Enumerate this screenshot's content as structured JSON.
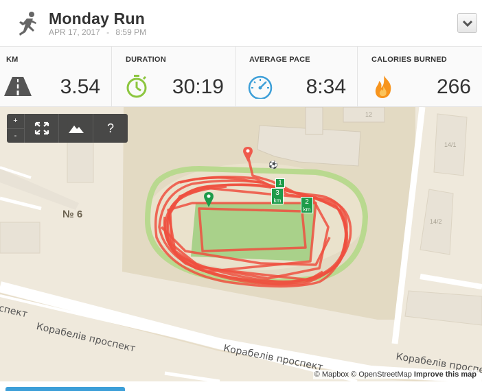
{
  "header": {
    "activity_icon": "runner-icon",
    "title": "Monday Run",
    "date": "APR 17, 2017",
    "separator": "-",
    "time": "8:59 PM",
    "dropdown_icon": "chevron-down-icon"
  },
  "stats": [
    {
      "label": "KM",
      "value": "3.54",
      "icon": "road-icon",
      "color": "#555555"
    },
    {
      "label": "DURATION",
      "value": "30:19",
      "icon": "stopwatch-icon",
      "color": "#8cc63f"
    },
    {
      "label": "AVERAGE PACE",
      "value": "8:34",
      "icon": "speedometer-icon",
      "color": "#3d9fd8"
    },
    {
      "label": "CALORIES BURNED",
      "value": "266",
      "icon": "flame-icon",
      "color": "#f7941d"
    }
  ],
  "map": {
    "controls": {
      "zoom_in": "+",
      "zoom_out": "-",
      "fullscreen_icon": "fullscreen-icon",
      "terrain_icon": "mountain-icon",
      "help": "?"
    },
    "labels": {
      "area": "№ 6",
      "street_1": "Корабелів проспект",
      "street_2": "Корабелів проспект",
      "street_3": "Корабелів проспект",
      "street_left_fragment": "спект",
      "building_12": "12",
      "building_14_1": "14/1",
      "building_14_2": "14/2"
    },
    "km_markers": [
      {
        "number": "1",
        "unit": ""
      },
      {
        "number": "2",
        "unit": "km"
      },
      {
        "number": "3",
        "unit": "km"
      }
    ],
    "attribution": {
      "mapbox": "© Mapbox",
      "osm": "© OpenStreetMap",
      "improve": "Improve this map"
    },
    "route_color": "#ee5040",
    "start_marker_color": "#1d9b4a",
    "end_marker_color": "#ef5a4c"
  }
}
